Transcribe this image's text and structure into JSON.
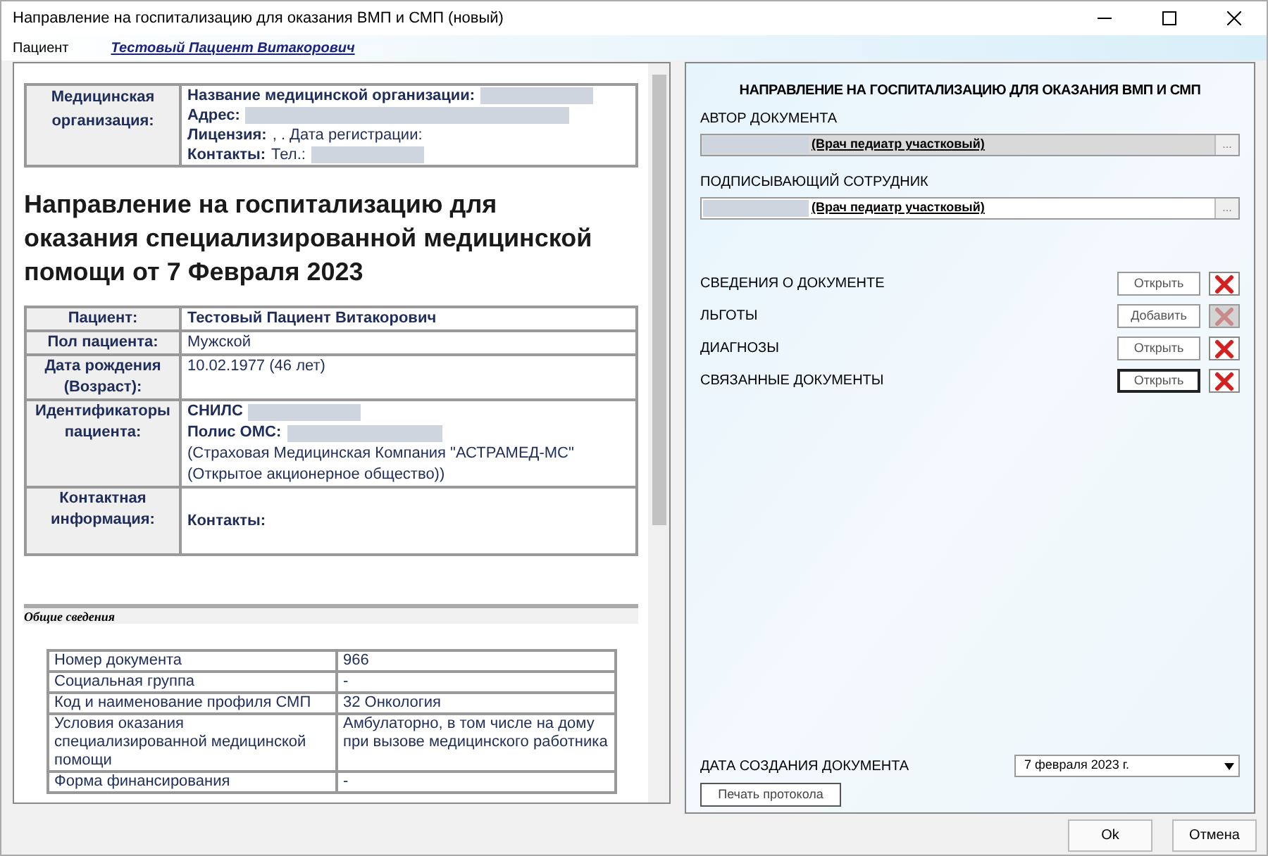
{
  "window": {
    "title": "Направление на госпитализацию для оказания ВМП и СМП (новый)"
  },
  "patient_bar": {
    "label": "Пациент",
    "patient_link": "Тестовый Пациент Витакорович"
  },
  "document": {
    "organization": {
      "header": "Медицинская организация:",
      "lines": [
        {
          "label": "Название медицинской организации:",
          "redacted": true
        },
        {
          "label": "Адрес:",
          "redacted": true
        },
        {
          "label": "Лицензия:",
          "value": ", . Дата регистрации:",
          "redacted": false
        },
        {
          "label": "Контакты:",
          "value": "Тел.:",
          "redacted": true
        }
      ]
    },
    "heading": "Направление на госпитализацию для оказания специализированной медицинской помощи от 7 Февраля 2023",
    "patient_rows": [
      {
        "label": "Пациент:",
        "lines": [
          {
            "value": "Тестовый Пациент Витакорович",
            "bold": true,
            "redacted": false
          }
        ]
      },
      {
        "label": "Пол пациента:",
        "lines": [
          {
            "value": "Мужской",
            "bold": false,
            "redacted": false
          }
        ]
      },
      {
        "label": "Дата рождения (Возраст):",
        "lines": [
          {
            "value": "10.02.1977 (46 лет)",
            "bold": false,
            "redacted": false
          }
        ]
      },
      {
        "label": "Идентификаторы пациента:",
        "lines": [
          {
            "label": "СНИЛС",
            "redacted": true
          },
          {
            "label": "Полис ОМС:",
            "value": "(Страховая Медицинская Компания \"АСТРАМЕД-МС\" (Открытое акционерное общество))",
            "bold": false,
            "redacted": true
          }
        ]
      },
      {
        "label": "Контактная информация:",
        "lines": [
          {
            "label": "Контакты:",
            "redacted": false
          }
        ]
      }
    ],
    "section_title": "Общие сведения",
    "general_rows": [
      {
        "name": "Номер документа",
        "value": "966"
      },
      {
        "name": "Социальная группа",
        "value": "-"
      },
      {
        "name": "Код и наименование профиля СМП",
        "value": "32 Онкология"
      },
      {
        "name": "Условия оказания специализированной медицинской помощи",
        "value": "Амбулаторно, в том числе на дому при вызове медицинского работника"
      },
      {
        "name": "Форма финансирования",
        "value": "-"
      }
    ]
  },
  "form": {
    "title": "НАПРАВЛЕНИЕ НА ГОСПИТАЛИЗАЦИЮ ДЛЯ ОКАЗАНИЯ ВМП И СМП",
    "fields": [
      {
        "label": "АВТОР ДОКУМЕНТА",
        "value": "(Врач педиатр участковый)",
        "readonly": true,
        "button": "..."
      },
      {
        "label": "ПОДПИСЫВАЮЩИЙ СОТРУДНИК",
        "value": "(Врач педиатр участковый)",
        "readonly": false,
        "button": "..."
      }
    ],
    "sections": [
      {
        "label": "СВЕДЕНИЯ О ДОКУМЕНТЕ",
        "action": "Открыть",
        "focused": false,
        "delete_disabled": false
      },
      {
        "label": "ЛЬГОТЫ",
        "action": "Добавить",
        "focused": false,
        "delete_disabled": true
      },
      {
        "label": "ДИАГНОЗЫ",
        "action": "Открыть",
        "focused": false,
        "delete_disabled": false
      },
      {
        "label": "СВЯЗАННЫЕ ДОКУМЕНТЫ",
        "action": "Открыть",
        "focused": true,
        "delete_disabled": false
      }
    ],
    "date": {
      "label": "ДАТА СОЗДАНИЯ ДОКУМЕНТА",
      "value": "7 февраля  2023 г."
    },
    "print_button": "Печать протокола"
  },
  "buttons": [
    "Ok",
    "Отмена"
  ]
}
